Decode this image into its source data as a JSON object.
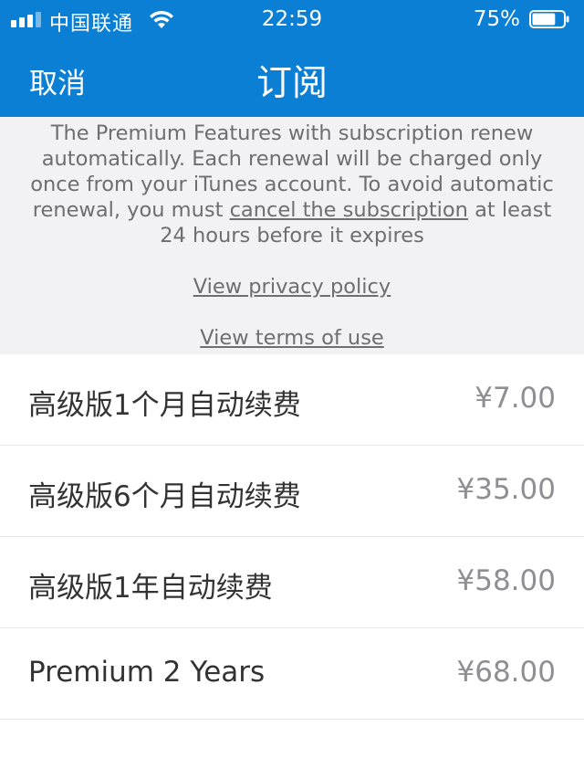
{
  "status_bar": {
    "carrier": "中国联通",
    "time": "22:59",
    "battery_percent": "75%",
    "battery_level": 0.75
  },
  "nav": {
    "cancel_label": "取消",
    "title": "订阅"
  },
  "info": {
    "text_before_link": "The Premium Features with subscription renew automatically. Each renewal will be charged only once from your iTunes account. To avoid automatic renewal, you must ",
    "cancel_link": "cancel the subscription",
    "text_after_link": " at least 24 hours before it expires",
    "privacy_link": "View privacy policy",
    "terms_link": "View terms of use"
  },
  "plans": [
    {
      "name": "高级版1个月自动续费",
      "price": "¥7.00"
    },
    {
      "name": "高级版6个月自动续费",
      "price": "¥35.00"
    },
    {
      "name": "高级版1年自动续费",
      "price": "¥58.00"
    },
    {
      "name": "Premium 2 Years",
      "price": "¥68.00"
    }
  ],
  "colors": {
    "header_bg": "#0a7fd4",
    "info_bg": "#f2f2f4",
    "price_text": "#8e8e93"
  }
}
